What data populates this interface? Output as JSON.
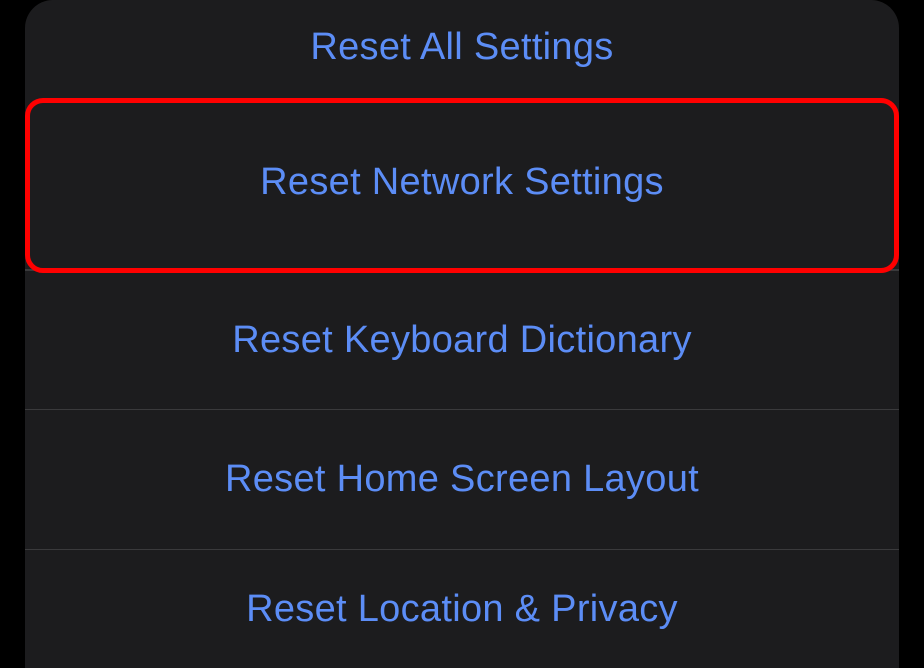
{
  "menu": {
    "items": [
      {
        "label": "Reset All Settings"
      },
      {
        "label": "Reset Network Settings"
      },
      {
        "label": "Reset Keyboard Dictionary"
      },
      {
        "label": "Reset Home Screen Layout"
      },
      {
        "label": "Reset Location & Privacy"
      }
    ]
  },
  "highlight": {
    "target_index": 1
  }
}
